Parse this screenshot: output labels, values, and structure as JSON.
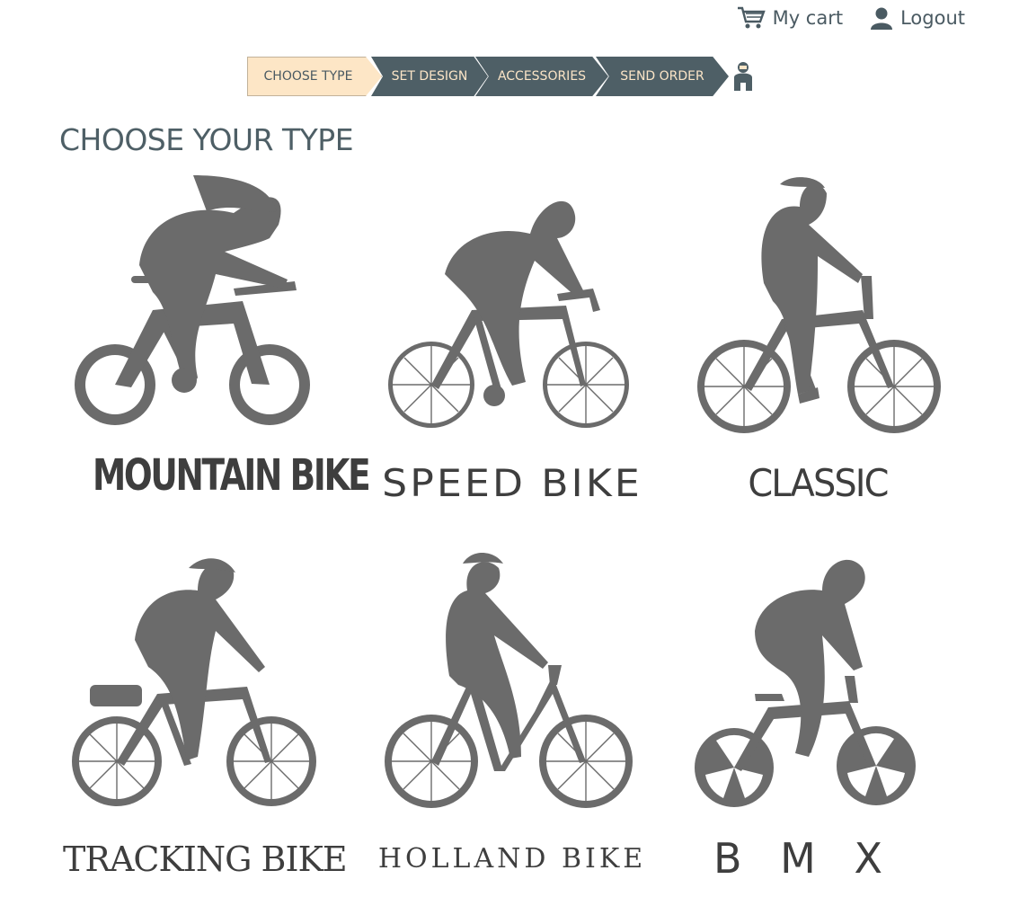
{
  "header": {
    "cart_label": "My cart",
    "logout_label": "Logout"
  },
  "steps": [
    {
      "label": "CHOOSE TYPE",
      "active": true
    },
    {
      "label": "SET DESIGN",
      "active": false
    },
    {
      "label": "ACCESSORIES",
      "active": false
    },
    {
      "label": "SEND ORDER",
      "active": false
    }
  ],
  "page_title": "CHOOSE YOUR TYPE",
  "bike_types": [
    {
      "label": "MOUNTAIN BIKE",
      "icon": "mountain-bike-rider-icon"
    },
    {
      "label": "SPEED BIKE",
      "icon": "speed-bike-rider-icon"
    },
    {
      "label": "CLASSIC",
      "icon": "classic-bike-rider-icon"
    },
    {
      "label": "TRACKING BIKE",
      "icon": "tracking-bike-rider-icon"
    },
    {
      "label": "HOLLAND BIKE",
      "icon": "holland-bike-rider-icon"
    },
    {
      "label": "B M X",
      "icon": "bmx-rider-icon"
    }
  ],
  "colors": {
    "accent_active": "#fde6c6",
    "step_dark": "#4e5f66",
    "step_text": "#fbe5c7",
    "silhouette": "#6b6b6b"
  }
}
